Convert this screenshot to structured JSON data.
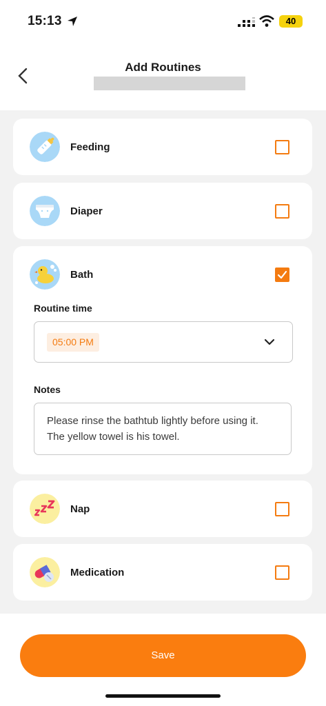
{
  "status_bar": {
    "time": "15:13",
    "battery": "40"
  },
  "header": {
    "title": "Add Routines"
  },
  "routines": [
    {
      "label": "Feeding",
      "icon": "baby-bottle-icon",
      "checked": false
    },
    {
      "label": "Diaper",
      "icon": "diaper-icon",
      "checked": false
    },
    {
      "label": "Bath",
      "icon": "rubber-duck-icon",
      "checked": true
    },
    {
      "label": "Nap",
      "icon": "zzz-icon",
      "checked": false
    },
    {
      "label": "Medication",
      "icon": "pill-icon",
      "checked": false
    }
  ],
  "bath_details": {
    "routine_time_label": "Routine time",
    "routine_time_value": "05:00 PM",
    "notes_label": "Notes",
    "notes_value": "Please rinse the bathtub lightly before using it. The yellow towel is his towel."
  },
  "footer": {
    "save_label": "Save"
  },
  "colors": {
    "accent": "#f47b10",
    "button": "#fa7d0f",
    "background": "#f2f2f2"
  }
}
